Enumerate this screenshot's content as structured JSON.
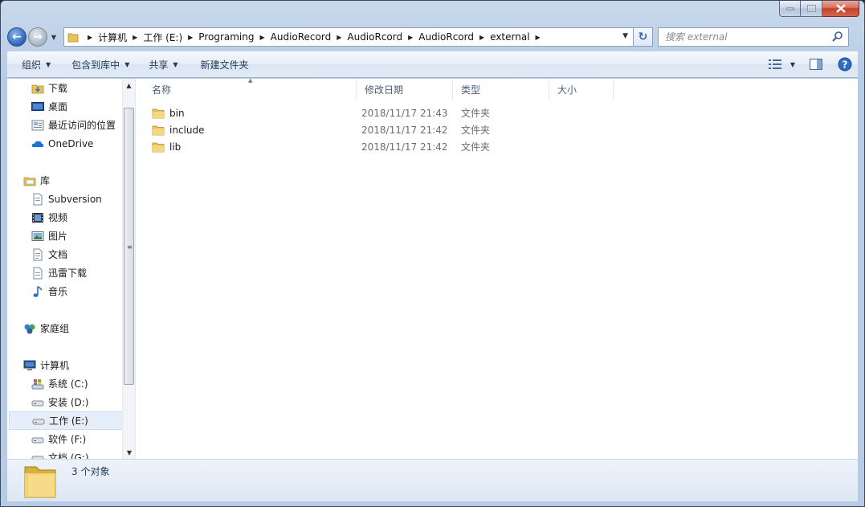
{
  "window": {
    "caption_buttons": [
      "minimize",
      "maximize",
      "close"
    ]
  },
  "address": {
    "crumbs": [
      "计算机",
      "工作 (E:)",
      "Programing",
      "AudioRecord",
      "AudioRcord",
      "AudioRcord",
      "external"
    ]
  },
  "search": {
    "placeholder": "搜索 external"
  },
  "toolbar": {
    "organize": "组织",
    "include_in_library": "包含到库中",
    "share": "共享",
    "new_folder": "新建文件夹"
  },
  "nav": {
    "items": [
      {
        "label": "下载",
        "icon": "downloads-folder-icon",
        "kind": "item"
      },
      {
        "label": "桌面",
        "icon": "desktop-icon",
        "kind": "item"
      },
      {
        "label": "最近访问的位置",
        "icon": "recent-places-icon",
        "kind": "item"
      },
      {
        "label": "OneDrive",
        "icon": "onedrive-cloud-icon",
        "kind": "item"
      },
      {
        "label": "库",
        "icon": "libraries-icon",
        "kind": "group"
      },
      {
        "label": "Subversion",
        "icon": "subversion-icon",
        "kind": "item"
      },
      {
        "label": "视频",
        "icon": "videos-icon",
        "kind": "item"
      },
      {
        "label": "图片",
        "icon": "pictures-icon",
        "kind": "item"
      },
      {
        "label": "文档",
        "icon": "documents-icon",
        "kind": "item"
      },
      {
        "label": "迅雷下载",
        "icon": "thunder-download-icon",
        "kind": "item"
      },
      {
        "label": "音乐",
        "icon": "music-icon",
        "kind": "item"
      },
      {
        "label": "家庭组",
        "icon": "homegroup-icon",
        "kind": "group"
      },
      {
        "label": "计算机",
        "icon": "computer-icon",
        "kind": "group"
      },
      {
        "label": "系统 (C:)",
        "icon": "system-drive-icon",
        "kind": "item"
      },
      {
        "label": "安装 (D:)",
        "icon": "drive-icon",
        "kind": "item"
      },
      {
        "label": "工作 (E:)",
        "icon": "drive-icon",
        "kind": "item",
        "selected": true
      },
      {
        "label": "软件 (F:)",
        "icon": "drive-icon",
        "kind": "item"
      },
      {
        "label": "文档 (G:)",
        "icon": "drive-icon",
        "kind": "item"
      }
    ]
  },
  "columns": {
    "name": "名称",
    "date_modified": "修改日期",
    "type": "类型",
    "size": "大小"
  },
  "files": [
    {
      "name": "bin",
      "date": "2018/11/17 21:43",
      "type": "文件夹"
    },
    {
      "name": "include",
      "date": "2018/11/17 21:42",
      "type": "文件夹"
    },
    {
      "name": "lib",
      "date": "2018/11/17 21:42",
      "type": "文件夹"
    }
  ],
  "status": {
    "item_count": "3 个对象"
  },
  "colors": {
    "folder": "#e8c25a",
    "selection": "#e5eef9",
    "header_text": "#4c607a",
    "toolbar_text": "#1e395b"
  }
}
